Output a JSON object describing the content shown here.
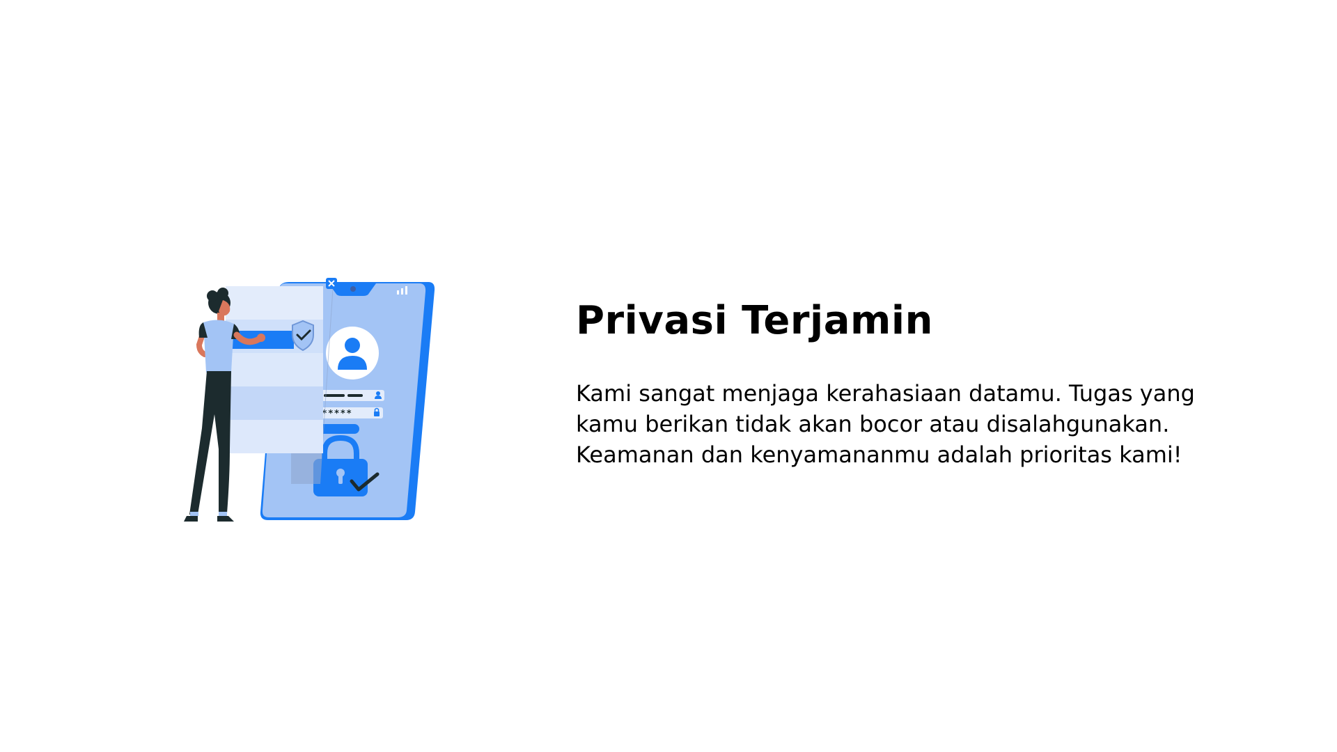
{
  "feature": {
    "title": "Privasi Terjamin",
    "description_lines": [
      "Kami sangat menjaga kerahasiaan datamu. Tugas yang",
      "kamu berikan tidak akan bocor atau disalahgunakan.",
      "Keamanan dan kenyamananmu adalah prioritas kami!"
    ]
  },
  "illustration": {
    "name": "privacy-security-illustration",
    "password_mask": "*****",
    "colors": {
      "accent": "#1a7cf5",
      "phone": "#a3c4f5",
      "panel": "#e3ecfb",
      "dark": "#1c2b2e"
    }
  }
}
